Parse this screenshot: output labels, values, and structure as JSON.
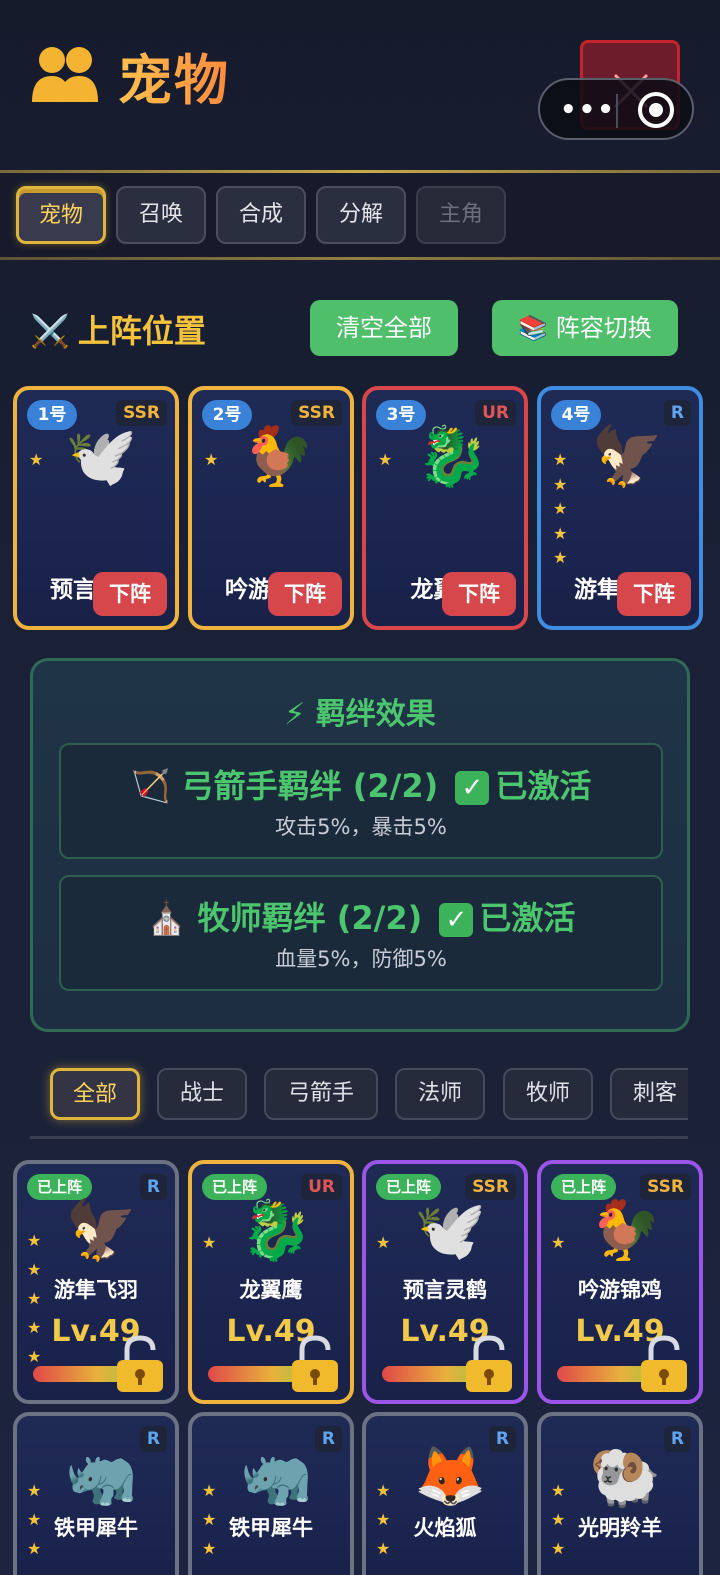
{
  "header": {
    "title": "宠物",
    "icon": "people-icon"
  },
  "top_tabs": [
    {
      "label": "宠物",
      "state": "active"
    },
    {
      "label": "召唤",
      "state": "normal"
    },
    {
      "label": "合成",
      "state": "normal"
    },
    {
      "label": "分解",
      "state": "normal"
    },
    {
      "label": "主角",
      "state": "disabled"
    }
  ],
  "lineup": {
    "title": "上阵位置",
    "clear_label": "清空全部",
    "switch_label": "📚 阵容切换",
    "slots": [
      {
        "pos": "1号",
        "rarity": "SSR",
        "emoji": "🕊️",
        "name": "预言灵鹤",
        "stars": 1,
        "unload": "下阵"
      },
      {
        "pos": "2号",
        "rarity": "SSR",
        "emoji": "🐓",
        "name": "吟游锦鸡",
        "stars": 1,
        "unload": "下阵"
      },
      {
        "pos": "3号",
        "rarity": "UR",
        "emoji": "🐉",
        "name": "龙翼鹰",
        "stars": 1,
        "unload": "下阵"
      },
      {
        "pos": "4号",
        "rarity": "R",
        "emoji": "🦅",
        "name": "游隼飞羽",
        "stars": 5,
        "unload": "下阵"
      }
    ]
  },
  "bonds": {
    "title": "⚡ 羁绊效果",
    "items": [
      {
        "icon": "🏹",
        "name": "弓箭手羁绊 (2/2)",
        "status": "已激活",
        "desc": "攻击5%，暴击5%"
      },
      {
        "icon": "⛪",
        "name": "牧师羁绊 (2/2)",
        "status": "已激活",
        "desc": "血量5%，防御5%"
      }
    ]
  },
  "filters": [
    {
      "label": "全部",
      "active": true
    },
    {
      "label": "战士",
      "active": false
    },
    {
      "label": "弓箭手",
      "active": false
    },
    {
      "label": "法师",
      "active": false
    },
    {
      "label": "牧师",
      "active": false
    },
    {
      "label": "刺客",
      "active": false
    }
  ],
  "collection": [
    {
      "in_lineup": "已上阵",
      "rarity": "R",
      "emoji": "🦅",
      "name": "游隼飞羽",
      "level": "Lv.49",
      "stars": 5
    },
    {
      "in_lineup": "已上阵",
      "rarity": "UR",
      "emoji": "🐉",
      "name": "龙翼鹰",
      "level": "Lv.49",
      "stars": 1
    },
    {
      "in_lineup": "已上阵",
      "rarity": "SSR",
      "emoji": "🕊️",
      "name": "预言灵鹤",
      "level": "Lv.49",
      "stars": 1
    },
    {
      "in_lineup": "已上阵",
      "rarity": "SSR",
      "emoji": "🐓",
      "name": "吟游锦鸡",
      "level": "Lv.49",
      "stars": 1
    },
    {
      "in_lineup": "",
      "rarity": "R",
      "emoji": "🦏",
      "name": "铁甲犀牛",
      "stars": 3
    },
    {
      "in_lineup": "",
      "rarity": "R",
      "emoji": "🦏",
      "name": "铁甲犀牛",
      "stars": 3
    },
    {
      "in_lineup": "",
      "rarity": "R",
      "emoji": "🦊",
      "name": "火焰狐",
      "stars": 3
    },
    {
      "in_lineup": "",
      "rarity": "R",
      "emoji": "🐏",
      "name": "光明羚羊",
      "stars": 3
    }
  ],
  "colors": {
    "accent_gold": "#e0b53c",
    "green": "#4fbf6b",
    "red": "#d5474a",
    "purple": "#9b55e8",
    "blue": "#3f8de0"
  }
}
